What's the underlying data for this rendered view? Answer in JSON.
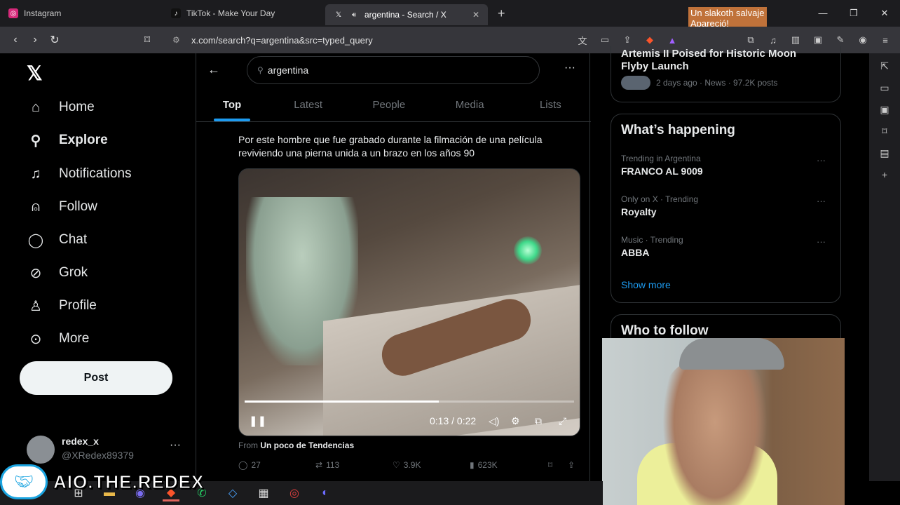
{
  "browser": {
    "tabs": [
      {
        "title": "Instagram",
        "icon": "instagram-icon"
      },
      {
        "title": "TikTok - Make Your Day",
        "icon": "tiktok-icon"
      },
      {
        "title": "argentina - Search / X",
        "icon": "x-icon",
        "active": true
      }
    ],
    "url": "x.com/search?q=argentina&src=typed_query",
    "overlay_note_line1": "Un slakoth salvaje",
    "overlay_note_line2": "Apareció!"
  },
  "nav": {
    "items": [
      {
        "label": "Home",
        "icon": "home-icon"
      },
      {
        "label": "Explore",
        "icon": "search-icon",
        "bold": true
      },
      {
        "label": "Notifications",
        "icon": "bell-icon"
      },
      {
        "label": "Follow",
        "icon": "add-user-icon"
      },
      {
        "label": "Chat",
        "icon": "chat-icon"
      },
      {
        "label": "Grok",
        "icon": "grok-icon"
      },
      {
        "label": "Profile",
        "icon": "person-icon"
      },
      {
        "label": "More",
        "icon": "more-circle-icon"
      }
    ],
    "post_label": "Post",
    "account_name": "redex_x",
    "account_handle": "@XRedex89379"
  },
  "search": {
    "query": "argentina",
    "tabs": [
      "Top",
      "Latest",
      "People",
      "Media",
      "Lists"
    ]
  },
  "tweet": {
    "text": "Por este hombre que fue grabado durante la filmación de una película reviviendo una pierna unida a un brazo en los años 90",
    "video_time": "0:13 / 0:22",
    "video_progress": 0.59,
    "from_prefix": "From",
    "from_source": "Un poco de Tendencias",
    "replies": "27",
    "reposts": "113",
    "likes": "3.9K",
    "views": "623K"
  },
  "right": {
    "top_trend_title": "Artemis II Poised for Historic Moon Flyby Launch",
    "top_trend_meta": "2 days ago · News · 97.2K posts",
    "happening_title": "What’s happening",
    "trends": [
      {
        "meta": "Trending in Argentina",
        "name": "FRANCO AL 9009"
      },
      {
        "meta": "Only on X · Trending",
        "name": "Royalty"
      },
      {
        "meta": "Music · Trending",
        "name": "ABBA"
      }
    ],
    "show_more": "Show more",
    "who_to_follow": "Who to follow"
  },
  "watermark": "AIO.THE.REDEX"
}
